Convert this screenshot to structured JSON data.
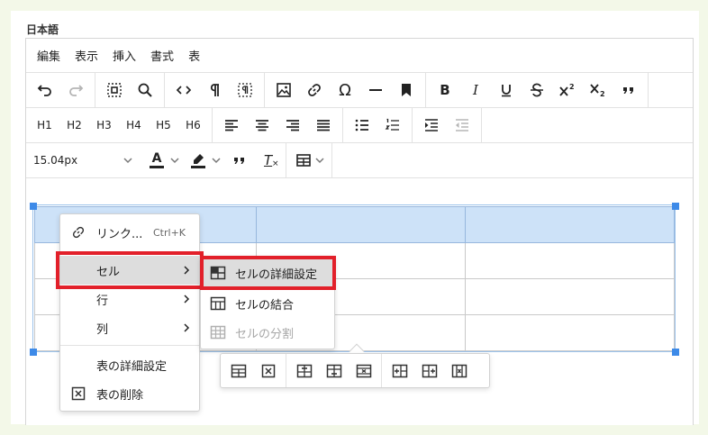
{
  "field_label": "日本語",
  "menubar": [
    "編集",
    "表示",
    "挿入",
    "書式",
    "表"
  ],
  "toolbar_row3": {
    "h_labels": [
      "H1",
      "H2",
      "H3",
      "H4",
      "H5",
      "H6"
    ]
  },
  "toolbar_row4": {
    "font_size": "15.04px",
    "font_color_glyph": "A",
    "clear_format_glyph": "T"
  },
  "context_menu": {
    "link_label": "リンク...",
    "link_shortcut": "Ctrl+K",
    "cell_label": "セル",
    "row_label": "行",
    "column_label": "列",
    "table_properties_label": "表の詳細設定",
    "delete_table_label": "表の削除"
  },
  "cell_submenu": {
    "cell_properties_label": "セルの詳細設定",
    "merge_cells_label": "セルの結合",
    "split_cell_label": "セルの分割"
  },
  "colors": {
    "highlight_red": "#e2202a",
    "selection_blue": "#cde2f8",
    "handle_blue": "#3d8ae8",
    "background": "#f3f8e8"
  },
  "icons": [
    "undo-icon",
    "redo-icon",
    "select-all-icon",
    "search-icon",
    "code-icon",
    "pilcrow-icon",
    "visual-blocks-icon",
    "image-icon",
    "link-icon",
    "omega-icon",
    "horizontal-rule-icon",
    "bookmark-icon",
    "bold-icon",
    "italic-icon",
    "underline-icon",
    "strikethrough-icon",
    "superscript-icon",
    "subscript-icon",
    "blockquote-icon",
    "align-left-icon",
    "align-center-icon",
    "align-right-icon",
    "justify-icon",
    "bullet-list-icon",
    "numbered-list-icon",
    "indent-icon",
    "outdent-icon",
    "text-color-icon",
    "highlight-icon",
    "quote-icon",
    "clear-format-icon",
    "table-icon"
  ]
}
